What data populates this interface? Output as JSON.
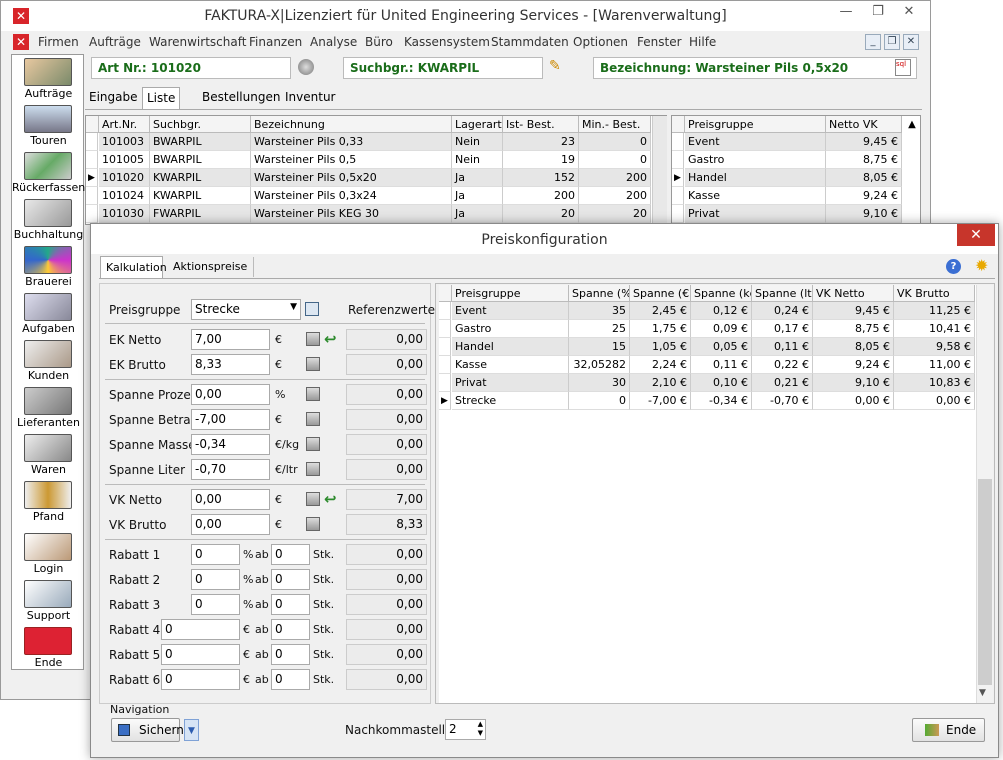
{
  "main": {
    "title": "FAKTURA-X|Lizenziert für United Engineering Services - [Warenverwaltung]",
    "menu": [
      "Firmen",
      "Aufträge",
      "Warenwirtschaft",
      "Finanzen",
      "Analyse",
      "Büro",
      "Kassensystem",
      "Stammdaten",
      "Optionen",
      "Fenster",
      "Hilfe"
    ],
    "sidebar": [
      "Aufträge",
      "Touren",
      "Rückerfassen",
      "Buchhaltung",
      "Brauerei",
      "Aufgaben",
      "Kunden",
      "Lieferanten",
      "Waren",
      "Pfand",
      "Login",
      "Support",
      "Ende"
    ],
    "art_nr": "Art Nr.: 101020",
    "suchbgr": "Suchbgr.: KWARPIL",
    "bezeichnung": "Bezeichnung: Warsteiner Pils 0,5x20",
    "tabs": [
      "Eingabe",
      "Liste",
      "Bestellungen",
      "Inventur"
    ],
    "list_headers": [
      "Art.Nr.",
      "Suchbgr.",
      "Bezeichnung",
      "Lagerartik",
      "Ist- Best.",
      "Min.- Best."
    ],
    "list_rows": [
      [
        "101003",
        "BWARPIL",
        "Warsteiner Pils 0,33",
        "Nein",
        "23",
        "0"
      ],
      [
        "101005",
        "BWARPIL",
        "Warsteiner Pils 0,5",
        "Nein",
        "19",
        "0"
      ],
      [
        "101020",
        "KWARPIL",
        "Warsteiner Pils 0,5x20",
        "Ja",
        "152",
        "200"
      ],
      [
        "101024",
        "KWARPIL",
        "Warsteiner Pils 0,3x24",
        "Ja",
        "200",
        "200"
      ],
      [
        "101030",
        "FWARPIL",
        "Warsteiner Pils KEG 30",
        "Ja",
        "20",
        "20"
      ]
    ],
    "price_headers": [
      "Preisgruppe",
      "Netto VK"
    ],
    "price_rows": [
      [
        "Event",
        "9,45 €"
      ],
      [
        "Gastro",
        "8,75 €"
      ],
      [
        "Handel",
        "8,05 €"
      ],
      [
        "Kasse",
        "9,24 €"
      ],
      [
        "Privat",
        "9,10 €"
      ]
    ]
  },
  "dialog": {
    "title": "Preiskonfiguration",
    "tabs": [
      "Kalkulation",
      "Aktionspreise"
    ],
    "preisgruppe_label": "Preisgruppe",
    "preisgruppe_value": "Strecke",
    "referenzwerte": "Referenzwerte",
    "fields": [
      {
        "label": "EK Netto",
        "value": "7,00",
        "unit": "€",
        "ref": "0,00"
      },
      {
        "label": "EK Brutto",
        "value": "8,33",
        "unit": "€",
        "ref": "0,00"
      },
      {
        "label": "Spanne Prozent",
        "value": "0,00",
        "unit": "%",
        "ref": "0,00"
      },
      {
        "label": "Spanne Betrag",
        "value": "-7,00",
        "unit": "€",
        "ref": "0,00"
      },
      {
        "label": "Spanne Masse",
        "value": "-0,34",
        "unit": "€/kg",
        "ref": "0,00"
      },
      {
        "label": "Spanne Liter",
        "value": "-0,70",
        "unit": "€/ltr",
        "ref": "0,00"
      },
      {
        "label": "VK Netto",
        "value": "0,00",
        "unit": "€",
        "ref": "7,00"
      },
      {
        "label": "VK Brutto",
        "value": "0,00",
        "unit": "€",
        "ref": "8,33"
      }
    ],
    "rabatte": [
      {
        "label": "Rabatt 1",
        "value": "0",
        "unit": "%",
        "ab": "ab",
        "qty": "0",
        "stk": "Stk.",
        "ref": "0,00"
      },
      {
        "label": "Rabatt 2",
        "value": "0",
        "unit": "%",
        "ab": "ab",
        "qty": "0",
        "stk": "Stk.",
        "ref": "0,00"
      },
      {
        "label": "Rabatt 3",
        "value": "0",
        "unit": "%",
        "ab": "ab",
        "qty": "0",
        "stk": "Stk.",
        "ref": "0,00"
      },
      {
        "label": "Rabatt 4",
        "value": "0",
        "unit": "€",
        "ab": "ab",
        "qty": "0",
        "stk": "Stk.",
        "ref": "0,00"
      },
      {
        "label": "Rabatt 5",
        "value": "0",
        "unit": "€",
        "ab": "ab",
        "qty": "0",
        "stk": "Stk.",
        "ref": "0,00"
      },
      {
        "label": "Rabatt 6",
        "value": "0",
        "unit": "€",
        "ab": "ab",
        "qty": "0",
        "stk": "Stk.",
        "ref": "0,00"
      }
    ],
    "grid_headers": [
      "Preisgruppe",
      "Spanne (%)",
      "Spanne (€)",
      "Spanne (kg",
      "Spanne (ltr",
      "VK Netto",
      "VK Brutto"
    ],
    "grid_rows": [
      [
        "Event",
        "35",
        "2,45 €",
        "0,12 €",
        "0,24 €",
        "9,45 €",
        "11,25 €"
      ],
      [
        "Gastro",
        "25",
        "1,75 €",
        "0,09 €",
        "0,17 €",
        "8,75 €",
        "10,41 €"
      ],
      [
        "Handel",
        "15",
        "1,05 €",
        "0,05 €",
        "0,11 €",
        "8,05 €",
        "9,58 €"
      ],
      [
        "Kasse",
        "32,05282",
        "2,24 €",
        "0,11 €",
        "0,22 €",
        "9,24 €",
        "11,00 €"
      ],
      [
        "Privat",
        "30",
        "2,10 €",
        "0,10 €",
        "0,21 €",
        "9,10 €",
        "10,83 €"
      ],
      [
        "Strecke",
        "0",
        "-7,00 €",
        "-0,34 €",
        "-0,70 €",
        "0,00 €",
        "0,00 €"
      ]
    ],
    "navigation_label": "Navigation",
    "sichern_label": "Sichern",
    "nachkommastellen_label": "Nachkommastellen",
    "nachkommastellen_value": "2",
    "ende_label": "Ende"
  },
  "colors": {
    "accent_green": "#1a6d1a",
    "close_red": "#c7352b",
    "app_red": "#d8252a"
  }
}
